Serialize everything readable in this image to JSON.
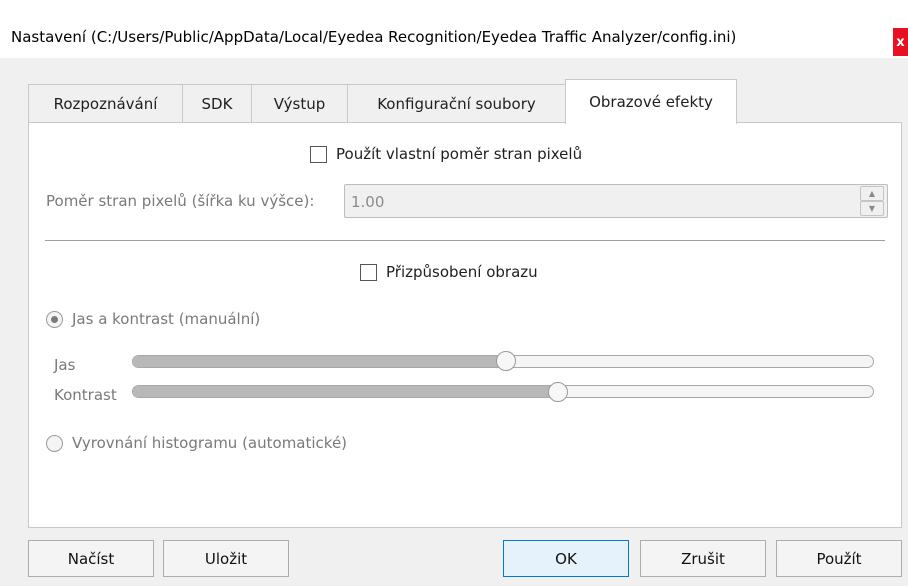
{
  "window": {
    "title": "Nastavení (C:/Users/Public/AppData/Local/Eyedea Recognition/Eyedea Traffic Analyzer/config.ini)",
    "close_label": "x"
  },
  "tabs": [
    {
      "label": "Rozpoznávání",
      "active": false
    },
    {
      "label": "SDK",
      "active": false
    },
    {
      "label": "Výstup",
      "active": false
    },
    {
      "label": "Konfigurační soubory",
      "active": false
    },
    {
      "label": "Obrazové efekty",
      "active": true
    }
  ],
  "image_effects": {
    "custom_aspect_checkbox": {
      "label": "Použít vlastní poměr stran pixelů",
      "checked": false
    },
    "aspect_ratio": {
      "label": "Poměr stran pixelů (šířka ku výšce):",
      "value": "1.00",
      "enabled": false
    },
    "image_adjust_checkbox": {
      "label": "Přizpůsobení obrazu",
      "checked": false
    },
    "manual_radio": {
      "label": "Jas a kontrast (manuální)",
      "checked": true,
      "enabled": false
    },
    "brightness": {
      "label": "Jas",
      "level": 0.5
    },
    "contrast": {
      "label": "Kontrast",
      "level": 0.58
    },
    "histogram_radio": {
      "label": "Vyrovnání histogramu (automatické)",
      "checked": false,
      "enabled": false
    }
  },
  "buttons": {
    "load": "Načíst",
    "save": "Uložit",
    "ok": "OK",
    "cancel": "Zrušit",
    "apply": "Použít"
  },
  "colors": {
    "accent": "#0078d7",
    "close": "#e81123"
  }
}
